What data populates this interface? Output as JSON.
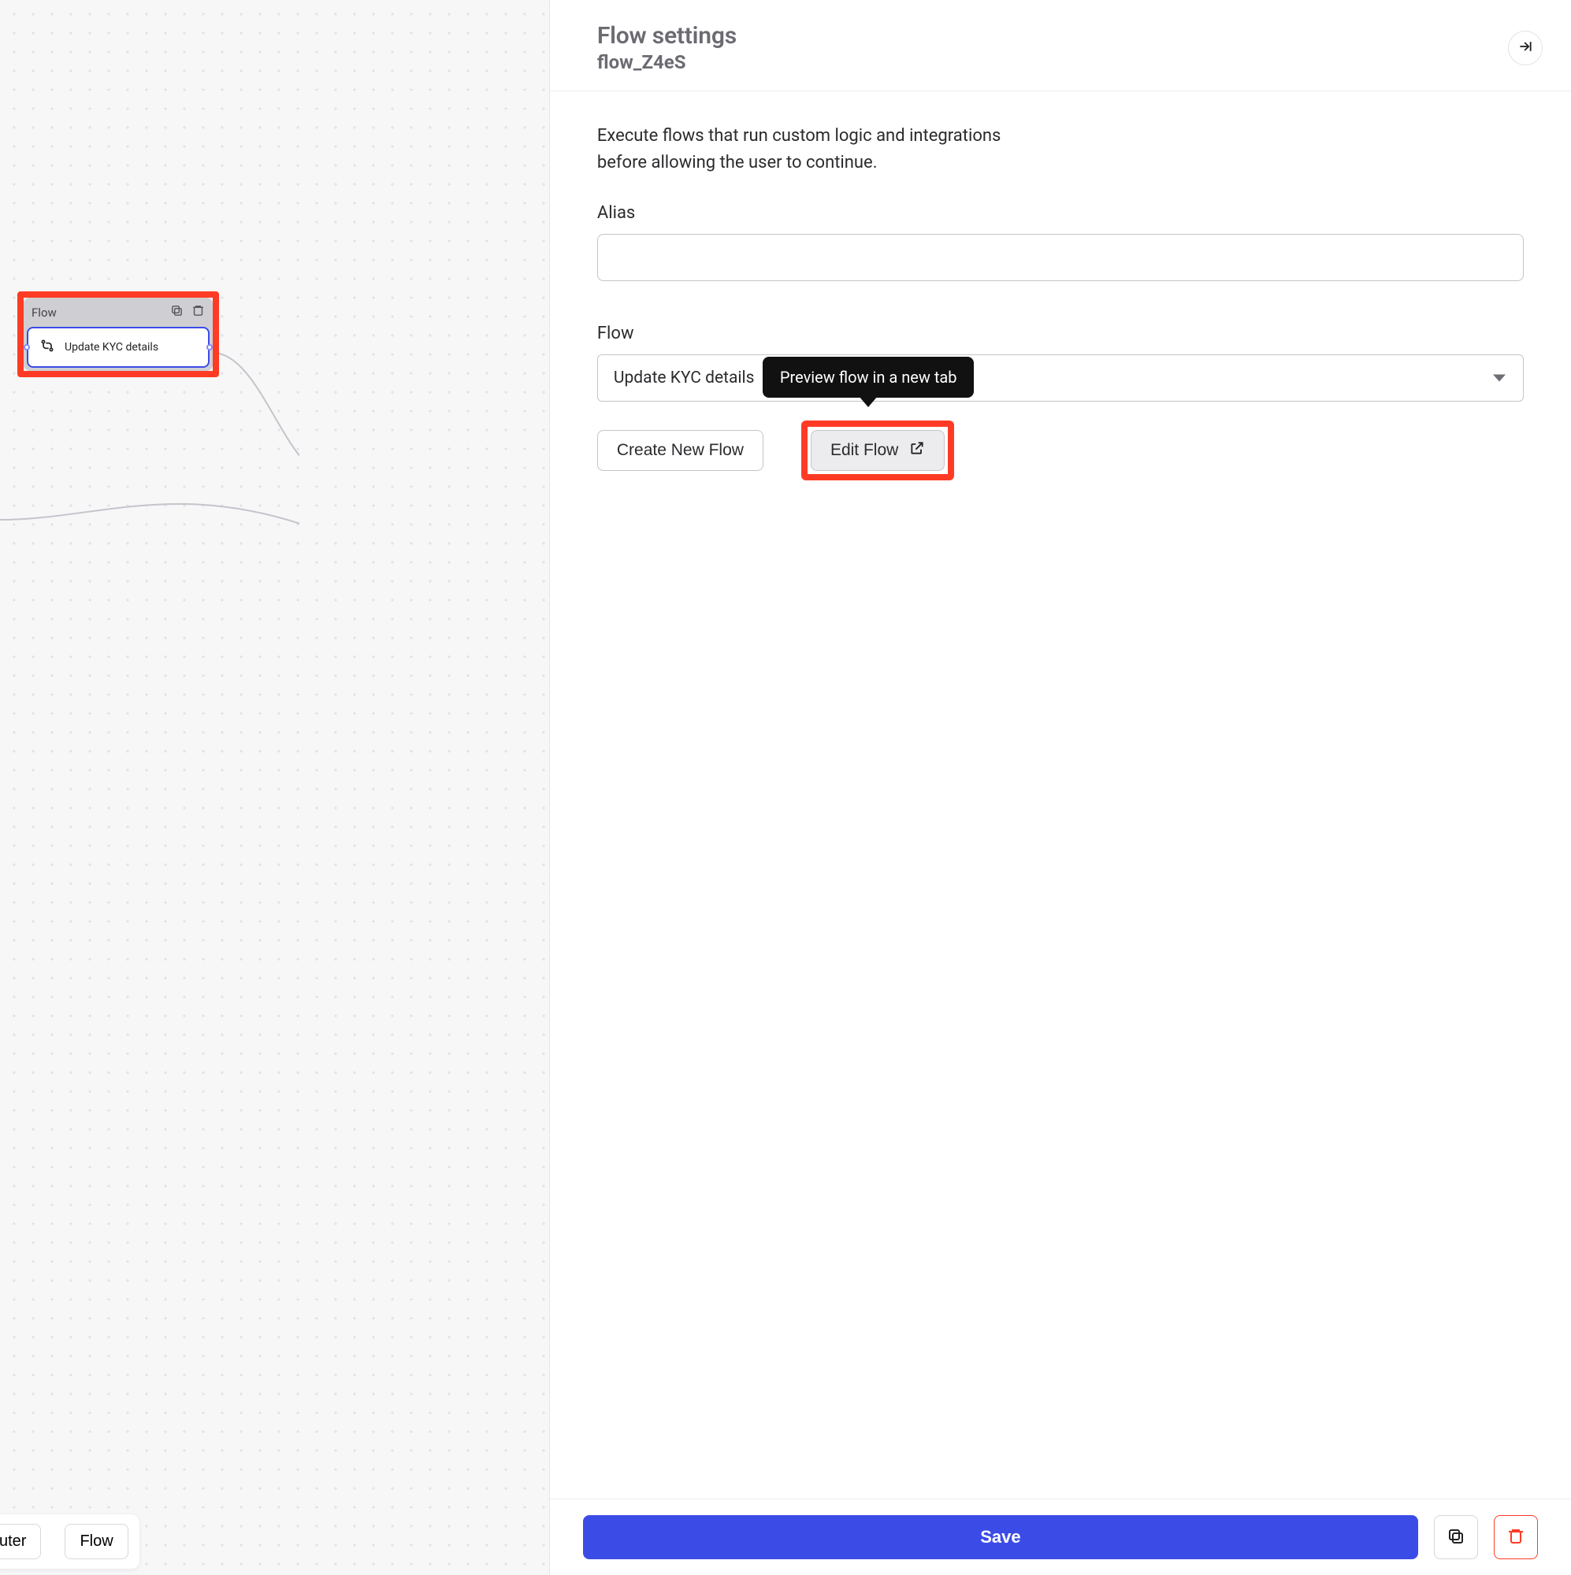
{
  "canvas": {
    "node": {
      "header_label": "Flow",
      "body_label": "Update KYC details"
    },
    "toolbar": {
      "router_label": "uter",
      "flow_label": "Flow"
    }
  },
  "panel": {
    "title": "Flow settings",
    "subtitle": "flow_Z4eS",
    "description": "Execute flows that run custom logic and integrations before allowing the user to continue.",
    "alias": {
      "label": "Alias",
      "value": ""
    },
    "flow": {
      "label": "Flow",
      "selected": "Update KYC details"
    },
    "tooltip": "Preview flow in a new tab",
    "buttons": {
      "create": "Create New Flow",
      "edit": "Edit Flow"
    },
    "footer": {
      "save": "Save"
    }
  }
}
